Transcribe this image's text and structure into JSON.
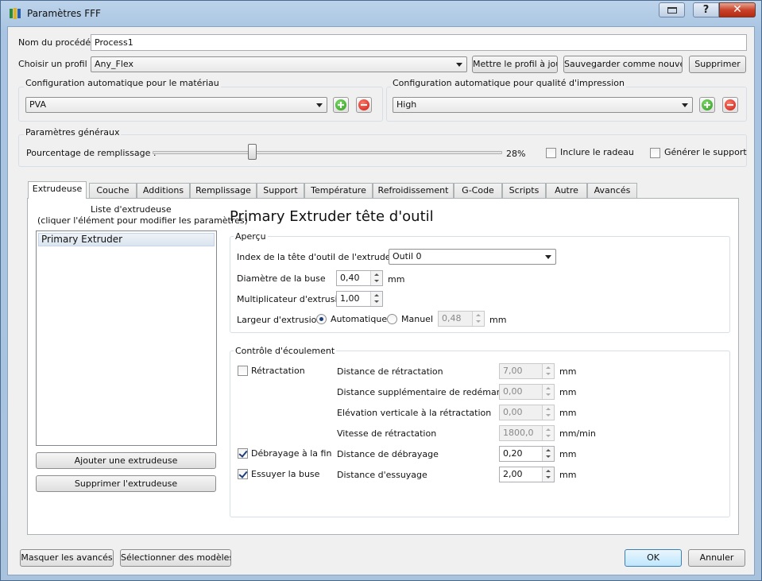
{
  "window": {
    "title": "Paramètres FFF"
  },
  "process": {
    "name_label": "Nom du procédé :",
    "name_value": "Process1"
  },
  "profile": {
    "label": "Choisir un profil :",
    "selected": "Any_Flex",
    "update_button": "Mettre le profil à jour",
    "save_new_button": "Sauvegarder comme nouveau",
    "delete_button": "Supprimer"
  },
  "material": {
    "group_title": "Configuration automatique pour le matériau",
    "selected": "PVA"
  },
  "quality": {
    "group_title": "Configuration automatique pour qualité d'impression",
    "selected": "High"
  },
  "general": {
    "group_title": "Paramètres généraux",
    "infill_label": "Pourcentage de remplissage :",
    "infill_percent": 28,
    "infill_text": "28%",
    "raft_label": "Inclure le radeau",
    "support_label": "Générer le support"
  },
  "tabs": [
    {
      "label": "Extrudeuse"
    },
    {
      "label": "Couche"
    },
    {
      "label": "Additions"
    },
    {
      "label": "Remplissage"
    },
    {
      "label": "Support"
    },
    {
      "label": "Température"
    },
    {
      "label": "Refroidissement"
    },
    {
      "label": "G-Code"
    },
    {
      "label": "Scripts"
    },
    {
      "label": "Autre"
    },
    {
      "label": "Avancés"
    }
  ],
  "extruder_list": {
    "title_line1": "Liste d'extrudeuse",
    "title_line2": "(cliquer l'élément pour modifier les paramètres)",
    "items": [
      "Primary Extruder"
    ],
    "add_button": "Ajouter une extrudeuse",
    "remove_button": "Supprimer l'extrudeuse"
  },
  "extruder_panel": {
    "heading": "Primary Extruder tête d'outil",
    "overview": {
      "group_title": "Aperçu",
      "index_label": "Index de la tête d'outil de l'extrudeuse",
      "index_value": "Outil 0",
      "nozzle_label": "Diamètre de la buse",
      "nozzle_value": "0,40",
      "nozzle_unit": "mm",
      "multiplier_label": "Multiplicateur d'extrusion",
      "multiplier_value": "1,00",
      "width_label": "Largeur d'extrusion",
      "auto_label": "Automatique",
      "manual_label": "Manuel",
      "width_value": "0,48",
      "width_unit": "mm"
    },
    "flow": {
      "group_title": "Contrôle d'écoulement",
      "retraction_label": "Rétractation",
      "coast_label": "Débrayage à la fin",
      "wipe_label": "Essuyer la buse",
      "retract_distance_label": "Distance de rétractation",
      "retract_distance_value": "7,00",
      "extra_restart_label": "Distance supplémentaire de redémarrage",
      "extra_restart_value": "0,00",
      "vertical_lift_label": "Elévation verticale à la rétractation",
      "vertical_lift_value": "0,00",
      "retract_speed_label": "Vitesse de rétractation",
      "retract_speed_value": "1800,0",
      "coast_distance_label": "Distance de débrayage",
      "coast_distance_value": "0,20",
      "wipe_distance_label": "Distance d'essuyage",
      "wipe_distance_value": "2,00",
      "unit_mm": "mm",
      "unit_mm_min": "mm/min"
    }
  },
  "footer": {
    "hide_advanced": "Masquer les avancés",
    "select_models": "Sélectionner des modèles",
    "ok": "OK",
    "cancel": "Annuler"
  }
}
